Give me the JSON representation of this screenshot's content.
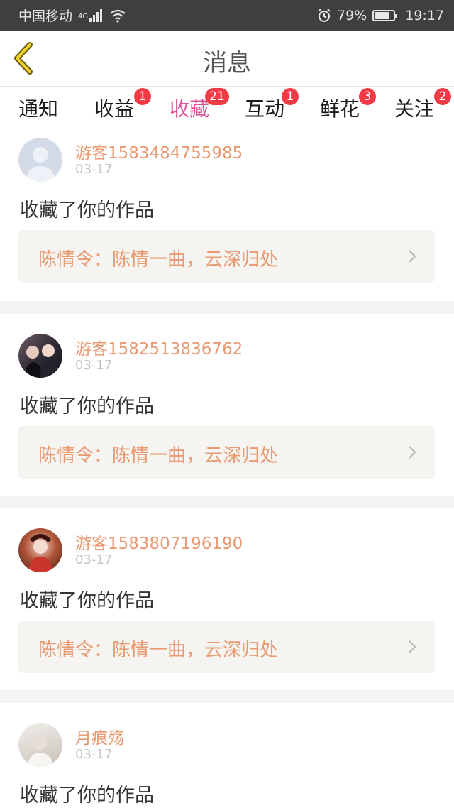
{
  "status": {
    "carrier": "中国移动",
    "network": "4G",
    "battery": "79%",
    "battery_level": 0.79,
    "time": "19:17"
  },
  "header": {
    "title": "消息"
  },
  "tabs": [
    {
      "label": "通知",
      "badge": ""
    },
    {
      "label": "收益",
      "badge": "1"
    },
    {
      "label": "收藏",
      "badge": "21",
      "active": true
    },
    {
      "label": "互动",
      "badge": "1"
    },
    {
      "label": "鲜花",
      "badge": "3"
    },
    {
      "label": "关注",
      "badge": "2"
    }
  ],
  "messages": [
    {
      "user": "游客1583484755985",
      "date": "03-17",
      "action": "收藏了你的作品",
      "work": "陈情令：陈情一曲，云深归处"
    },
    {
      "user": "游客1582513836762",
      "date": "03-17",
      "action": "收藏了你的作品",
      "work": "陈情令：陈情一曲，云深归处"
    },
    {
      "user": "游客1583807196190",
      "date": "03-17",
      "action": "收藏了你的作品",
      "work": "陈情令：陈情一曲，云深归处"
    },
    {
      "user": "月痕殇",
      "date": "03-17",
      "action": "收藏了你的作品",
      "work": ""
    }
  ],
  "colors": {
    "accent": "#e0559a",
    "name": "#e89a72",
    "badge": "#f23b44"
  }
}
